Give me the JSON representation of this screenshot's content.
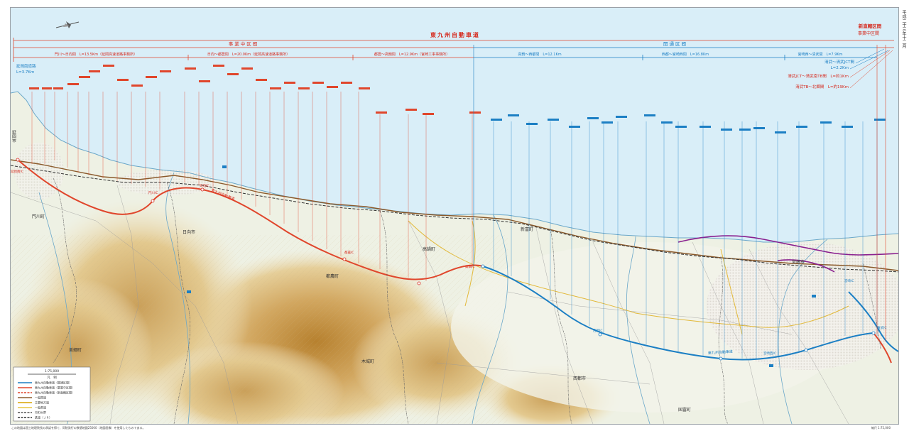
{
  "map": {
    "title": "東九州自動車道",
    "sections": {
      "under_construction": "事業中区間",
      "open": "開通区間"
    },
    "right_header": {
      "line1": "新直轄区間",
      "line2": "事業中区間"
    },
    "segments": [
      {
        "label": "門川～日向間　L=13.5Km（延岡高速道路事務所）",
        "kind": "construction"
      },
      {
        "label": "日向～都農間　L=20.0Km（延岡高速道路事務所）",
        "kind": "construction"
      },
      {
        "label": "都農～高鍋間　L=12.9Km（宮崎工事事務所）",
        "kind": "construction"
      },
      {
        "label": "高鍋～西都間　L=12.1Km",
        "kind": "open"
      },
      {
        "label": "西都～宮崎西間　L=16.8Km",
        "kind": "open"
      },
      {
        "label": "宮崎西～清武間　L=7.9Km",
        "kind": "open"
      }
    ],
    "left_note": {
      "line1": "延岡南道路",
      "line2": "L=3.7Km"
    },
    "right_notes": [
      {
        "text": "清武～清武JCT間",
        "kind": "open"
      },
      {
        "text": "L=2.2Km",
        "kind": "open"
      },
      {
        "text": "清武JCT～清武南TB間　L=約1Km",
        "kind": "construction"
      },
      {
        "text": "清武TB～北郷間　L=約19Km",
        "kind": "construction"
      }
    ],
    "place_names": [
      {
        "id": "nobeoka",
        "text": "延岡市"
      },
      {
        "id": "kadogawa",
        "text": "門川町"
      },
      {
        "id": "hyuga",
        "text": "日向市"
      },
      {
        "id": "tsuno",
        "text": "都農町"
      },
      {
        "id": "takanabe",
        "text": "高鍋町"
      },
      {
        "id": "kijo",
        "text": "木城町"
      },
      {
        "id": "saito",
        "text": "西都市"
      },
      {
        "id": "shintomi",
        "text": "新富町"
      },
      {
        "id": "miyazaki",
        "text": "宮崎市"
      },
      {
        "id": "kunitomi",
        "text": "国富町"
      },
      {
        "id": "morotsuka",
        "text": "美郷町"
      }
    ],
    "interchanges": [
      {
        "id": "nobeoka-minami",
        "text": "延岡南IC"
      },
      {
        "id": "kadogawa-ic",
        "text": "門川IC"
      },
      {
        "id": "hyuga-ic",
        "text": "日向IC"
      },
      {
        "id": "tsuno-ic",
        "text": "都農IC"
      },
      {
        "id": "takanabe-ic",
        "text": "高鍋IC"
      },
      {
        "id": "saito-ic",
        "text": "西都IC"
      },
      {
        "id": "miyazaki-nishi",
        "text": "宮崎西IC"
      },
      {
        "id": "kiyotake-ic",
        "text": "清武IC"
      },
      {
        "id": "miyazaki-ic",
        "text": "宮崎IC"
      }
    ],
    "route_label": "東九州自動車道",
    "scale": "1:75,000",
    "side_text": "平成二十三年十二月",
    "footer_left": "この地図は国土地理院長の承認を得て、同院発行の数値地図25000（地図画像）を使用したものである。",
    "footer_right": "縮尺 1:75,000"
  },
  "legend": {
    "title": "凡　例",
    "items": [
      {
        "label": "東九州自動車道（開通区間）",
        "color": "#1c7fc4"
      },
      {
        "label": "東九州自動車道（事業中区間）",
        "color": "#e0462c"
      },
      {
        "label": "東九州自動車道（新直轄区間）",
        "color": "#e0462c"
      },
      {
        "label": "一般国道",
        "color": "#8b5a2b"
      },
      {
        "label": "主要地方道",
        "color": "#d9a400"
      },
      {
        "label": "一般県道",
        "color": "#e8c640"
      },
      {
        "label": "市町村界",
        "color": "#555555"
      },
      {
        "label": "鉄道（ＪＲ）",
        "color": "#333333"
      }
    ]
  },
  "colors": {
    "sea": "#d9eef8",
    "land": "#eef1e4",
    "open_route": "#1c7fc4",
    "construction_route": "#e0462c",
    "other_route": "#8a1f8f",
    "national_road": "#8b5a2b"
  }
}
